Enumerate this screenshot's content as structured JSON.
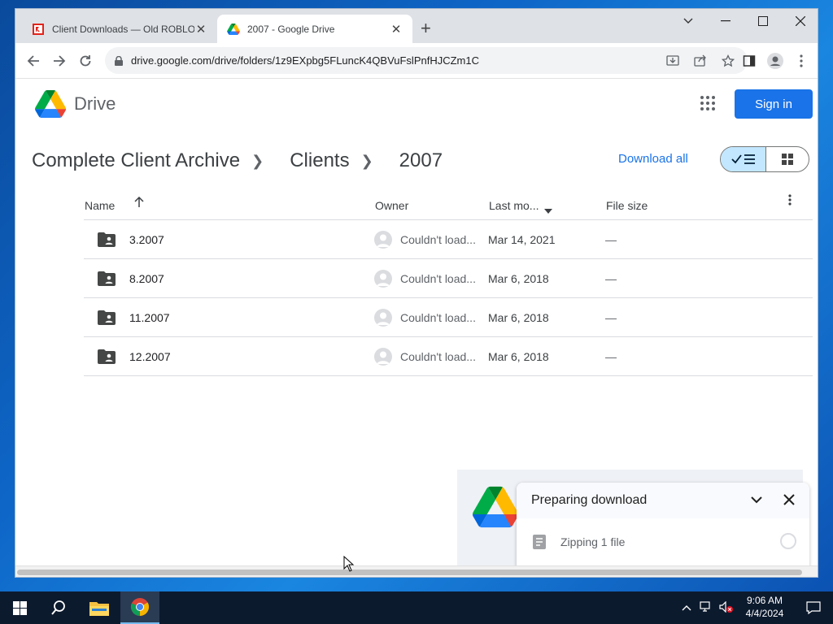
{
  "browser": {
    "tabs": [
      {
        "title": "Client Downloads — Old ROBLOX",
        "active": false
      },
      {
        "title": "2007 - Google Drive",
        "active": true
      }
    ],
    "url": "drive.google.com/drive/folders/1z9EXpbg5FLuncK4QBVuFslPnfHJCZm1C"
  },
  "drive": {
    "logo_text": "Drive",
    "signin_label": "Sign in",
    "breadcrumb": [
      "Complete Client Archive",
      "Clients",
      "2007"
    ],
    "download_all": "Download all",
    "columns": {
      "name": "Name",
      "owner": "Owner",
      "modified": "Last mo...",
      "size": "File size"
    },
    "rows": [
      {
        "name": "3.2007",
        "owner": "Couldn't load...",
        "modified": "Mar 14, 2021",
        "size": "—"
      },
      {
        "name": "8.2007",
        "owner": "Couldn't load...",
        "modified": "Mar 6, 2018",
        "size": "—"
      },
      {
        "name": "11.2007",
        "owner": "Couldn't load...",
        "modified": "Mar 6, 2018",
        "size": "—"
      },
      {
        "name": "12.2007",
        "owner": "Couldn't load...",
        "modified": "Mar 6, 2018",
        "size": "—"
      }
    ]
  },
  "download_panel": {
    "title": "Preparing download",
    "item": "Zipping 1 file"
  },
  "taskbar": {
    "time": "9:06 AM",
    "date": "4/4/2024"
  },
  "colors": {
    "accent": "#1a73e8",
    "toggle_selected": "#c2e7ff"
  }
}
